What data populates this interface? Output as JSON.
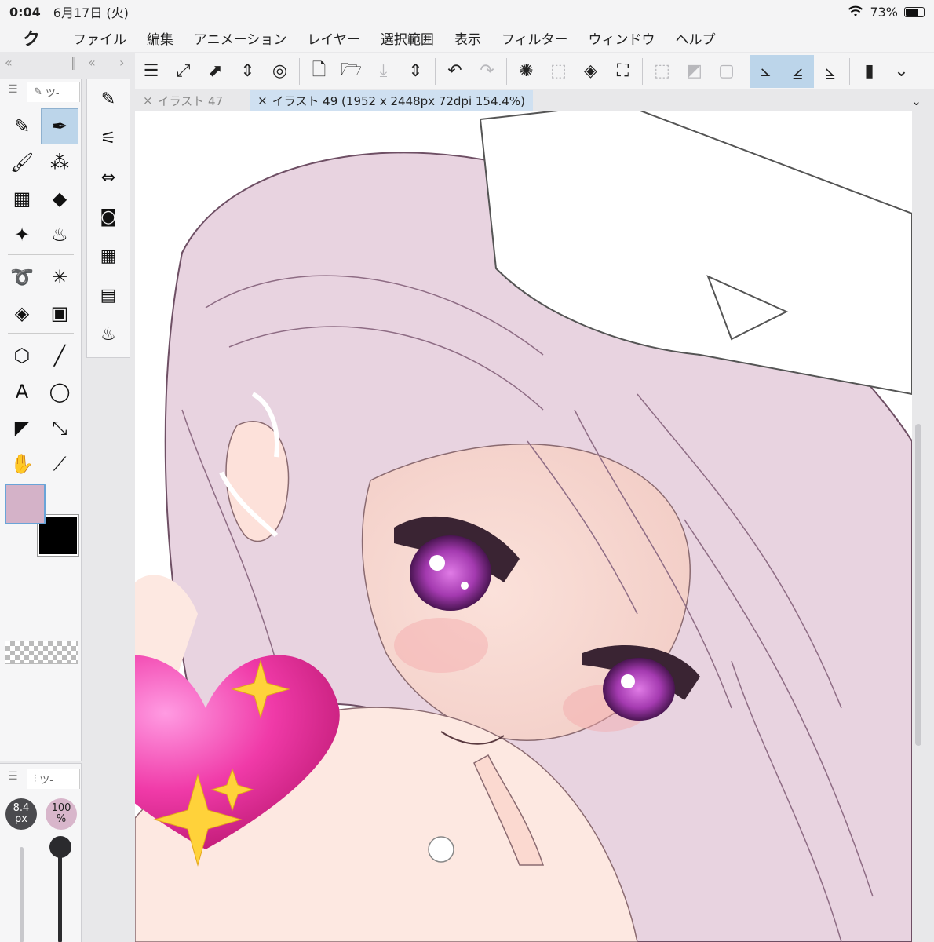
{
  "status": {
    "time": "0:04",
    "date": "6月17日 (火)",
    "battery": "73%",
    "battery_level": 0.73
  },
  "menu": {
    "logo": "ク",
    "items": [
      "ファイル",
      "編集",
      "アニメーション",
      "レイヤー",
      "選択範囲",
      "表示",
      "フィルター",
      "ウィンドウ",
      "ヘルプ"
    ]
  },
  "tool_palette": {
    "tab_label": "ツ-"
  },
  "brush_panel": {
    "tab_label": "ツ-",
    "size_value": "8.4",
    "size_unit": "px",
    "opacity_value": "100",
    "opacity_unit": "%",
    "opacity_level": 1.0
  },
  "colors": {
    "main": "#d4b2c8",
    "sub": "#000000",
    "accent": "#bcd5ea"
  },
  "tabs": {
    "inactive": "イラスト 47",
    "active": "イラスト 49 (1952 x 2448px 72dpi 154.4%)"
  }
}
